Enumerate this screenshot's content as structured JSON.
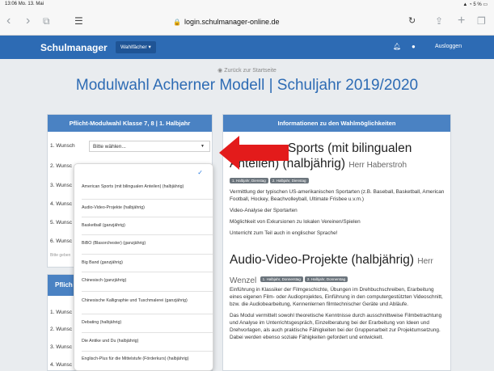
{
  "status": {
    "time": "13:06",
    "date": "Mo. 13. Mai",
    "battery": "5 %"
  },
  "browser": {
    "url": "login.schulmanager-online.de"
  },
  "navbar": {
    "brand": "Schulmanager",
    "wahl_label": "Wahlfächer ▾",
    "logout": "Ausloggen"
  },
  "page": {
    "back_link": "Zurück zur Startseite",
    "title": "Modulwahl Acherner Modell | Schuljahr 2019/2020"
  },
  "left_panel": {
    "heading": "Pflicht-Modulwahl Klasse 7, 8 | 1. Halbjahr",
    "rows": [
      "1. Wunsch",
      "2. Wunsc",
      "3. Wunsc",
      "4. Wunsc",
      "5. Wunsc",
      "6. Wunsc"
    ],
    "select_placeholder": "Bitte wählen...",
    "hint": "Bitte geben"
  },
  "left_panel2": {
    "heading": "Pflich",
    "rows": [
      "1. Wunsc",
      "2. Wunsc",
      "3. Wunsc",
      "4. Wunsc"
    ]
  },
  "dropdown": {
    "items": [
      "American Sports (mit bilingualen Anteilen) (halbjährig)",
      "Audio-Video-Projekte (halbjährig)",
      "Basketball (ganzjährig)",
      "BiBO (Blasorchester) (ganzjährig)",
      "Big Band (ganzjährig)",
      "Chinesisch (ganzjährig)",
      "Chinesische Kalligraphie und Tuschmalerei (ganzjährig)",
      "Debating (halbjährig)",
      "Die Antike und Du (halbjährig)",
      "Englisch-Plus für die Mittelstufe (Förderkurs) (halbjährig)"
    ]
  },
  "right_panel": {
    "heading": "Informationen zu den Wahlmöglichkeiten",
    "course1": {
      "title_line1": "Sports (mit bilingualen",
      "title_line2": "Anteilen) (halbjährig)",
      "teacher": "Herr Haberstroh",
      "badges": [
        "1. Halbjahr, Dienstag",
        "2. Halbjahr, Dienstag"
      ],
      "p1": "Vermittlung der typischen US-amerikanischen Sportarten (z.B. Baseball, Basketball, American Football, Hockey, Beachvolleyball, Ultimate Frisbee u.v.m.)",
      "p2": "Video-Analyse der Sportarten",
      "p3": "Möglichkeit von Exkursionen zu lokalen Vereinen/Spielen",
      "p4": "Unterricht zum Teil auch in englischer Sprache!"
    },
    "course2": {
      "title": "Audio-Video-Projekte (halbjährig)",
      "teacher_a": "Herr",
      "teacher_b": "Wenzel",
      "badges": [
        "1. Halbjahr, Donnerstag",
        "2. Halbjahr, Donnerstag"
      ],
      "p1": "Einführung in Klassiker der Filmgeschichte, Übungen im Drehbuchschreiben, Erarbeitung eines eigenen Film- oder Audioprojektes, Einführung in den computergestützten Videoschnitt, bzw. die Audiobearbeitung, Kennenlernen filmtechnischer Geräte und Abläufe.",
      "p2": "Das Modul vermittelt sowohl theoretische Kenntnisse durch ausschnittweise Filmbetrachtung und Analyse im Unterrichtsgespräch, Einzelberatung bei der Erarbeitung von Ideen und Drehvorlagen, als auch praktische Fähigkeiten bei der Gruppenarbeit zur Projektumsetzung. Dabei werden ebenso soziale Fähigkeiten gefordert und entwickelt."
    }
  },
  "colors": {
    "nav": "#2d6bb4",
    "panel_head": "#4a82c3",
    "arrow": "#e31b1b"
  }
}
